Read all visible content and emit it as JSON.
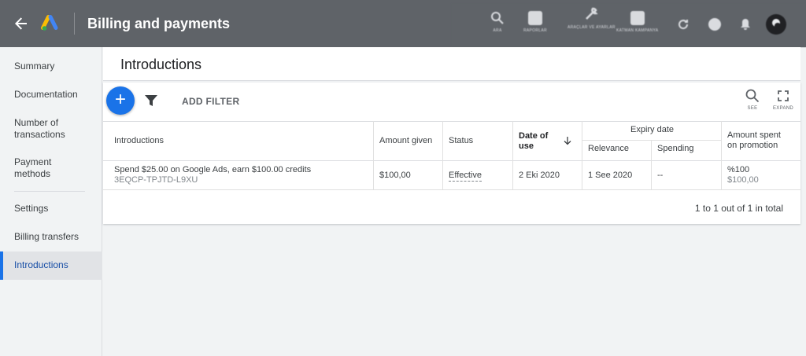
{
  "header": {
    "title": "Billing and payments",
    "tools": [
      {
        "name": "search-tool",
        "label": "ARA"
      },
      {
        "name": "reports-tool",
        "label": "RAPORLAR"
      },
      {
        "name": "tools-settings",
        "label": "ARAÇLAR VE AYARLAR"
      },
      {
        "name": "campaigns-tool",
        "label": "KATMAN KAMPANYA"
      }
    ]
  },
  "sidebar": {
    "items": [
      {
        "label": "Summary"
      },
      {
        "label": "Documentation"
      },
      {
        "label": "Number of transactions"
      },
      {
        "label": "Payment methods"
      },
      {
        "label": "Settings"
      },
      {
        "label": "Billing transfers"
      },
      {
        "label": "Introductions"
      }
    ]
  },
  "main": {
    "title": "Introductions",
    "add_filter": "ADD FILTER",
    "see_label": "SEE",
    "expand_label": "EXPAND"
  },
  "table": {
    "headers": {
      "introductions": "Introductions",
      "amount_given": "Amount given",
      "status": "Status",
      "date_of_use_1": "Date of",
      "date_of_use_2": "use",
      "expiry_date": "Expiry date",
      "relevance": "Relevance",
      "spending": "Spending",
      "amount_spent_1": "Amount spent",
      "amount_spent_2": "on promotion"
    },
    "rows": [
      {
        "title": "Spend $25.00 on Google Ads, earn $100.00 credits",
        "code": "3EQCP-TPJTD-L9XU",
        "amount_given": "$100,00",
        "status": "Effective",
        "date_of_use": "2 Eki 2020",
        "relevance": "1 See 2020",
        "spending": "--",
        "amount_spent_pct": "%100",
        "amount_spent_value": "$100,00"
      }
    ],
    "pagination": "1 to 1 out of 1 in total"
  },
  "colors": {
    "header_bg": "#5f6368",
    "accent": "#1a73e8",
    "sidebar_active_bg": "#e1e3e6"
  }
}
